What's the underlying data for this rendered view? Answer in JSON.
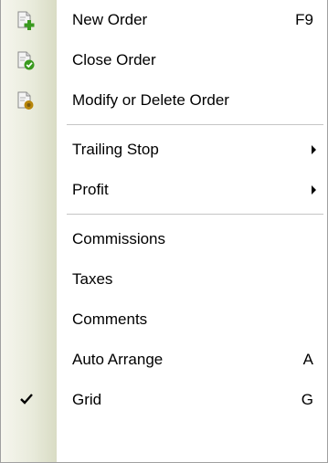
{
  "menu": {
    "groups": [
      {
        "items": [
          {
            "label": "New Order",
            "shortcut": "F9",
            "icon": "new-order-icon"
          },
          {
            "label": "Close Order",
            "icon": "close-order-icon"
          },
          {
            "label": "Modify or Delete Order",
            "icon": "modify-order-icon"
          }
        ]
      },
      {
        "items": [
          {
            "label": "Trailing Stop",
            "icon": "submenu-arrow-icon"
          },
          {
            "label": "Profit",
            "icon": "submenu-arrow-icon"
          }
        ]
      },
      {
        "items": [
          {
            "label": "Commissions"
          },
          {
            "label": "Taxes"
          },
          {
            "label": "Comments"
          },
          {
            "label": "Auto Arrange",
            "shortcut": "A"
          },
          {
            "label": "Grid",
            "shortcut": "G",
            "checked": true,
            "icon": "checkmark-icon"
          }
        ]
      }
    ]
  },
  "colors": {
    "gutter_light": "#f6f6ee",
    "gutter_dark": "#d9dcc4",
    "separator": "#c5c5c5",
    "icon_green": "#3a9a1f",
    "icon_gold": "#b8860b"
  }
}
